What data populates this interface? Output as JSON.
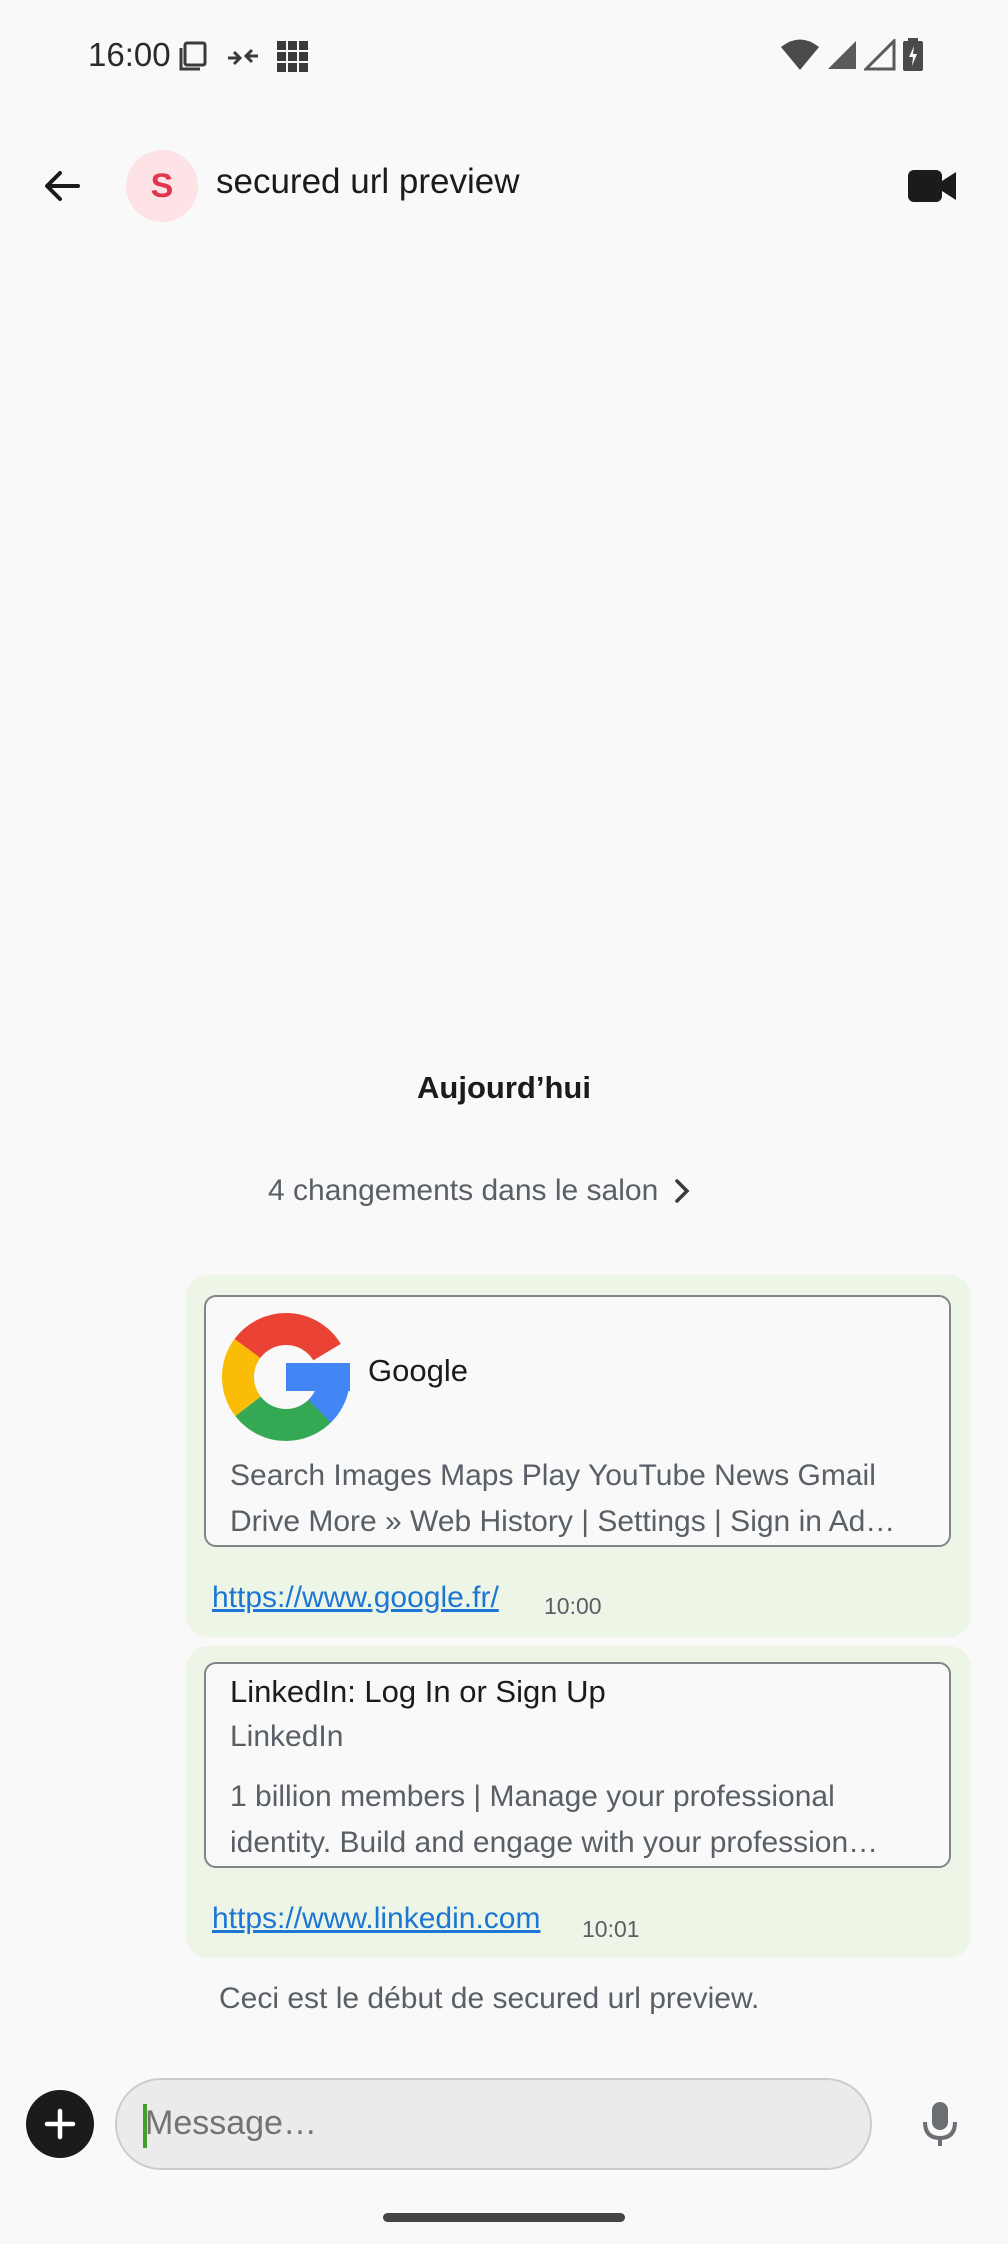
{
  "status_bar": {
    "time": "16:00"
  },
  "header": {
    "avatar_letter": "S",
    "room_name": "secured url preview"
  },
  "timeline": {
    "date_separator": "Aujourd’hui",
    "room_changes": "4 changements dans le salon",
    "messages": [
      {
        "preview": {
          "site_name": "Google",
          "description_line1": "Search Images Maps Play YouTube News Gmail",
          "description_line2": "Drive More » Web History | Settings | Sign in Ad…"
        },
        "link": "https://www.google.fr/",
        "time": "10:00"
      },
      {
        "preview": {
          "title": "LinkedIn: Log In or Sign Up",
          "site_name": "LinkedIn",
          "description_line1": "1 billion members | Manage your professional",
          "description_line2": "identity. Build and engage with your profession…"
        },
        "link": "https://www.linkedin.com",
        "time": "10:01"
      }
    ],
    "room_start_notice": "Ceci est le début de secured url preview."
  },
  "composer": {
    "placeholder": "Message…"
  },
  "colors": {
    "bubble": "#edf6e6",
    "link": "#1d76d4",
    "avatar_bg": "#fde3e6",
    "avatar_fg": "#e0364f",
    "caret": "#3fa12b"
  }
}
